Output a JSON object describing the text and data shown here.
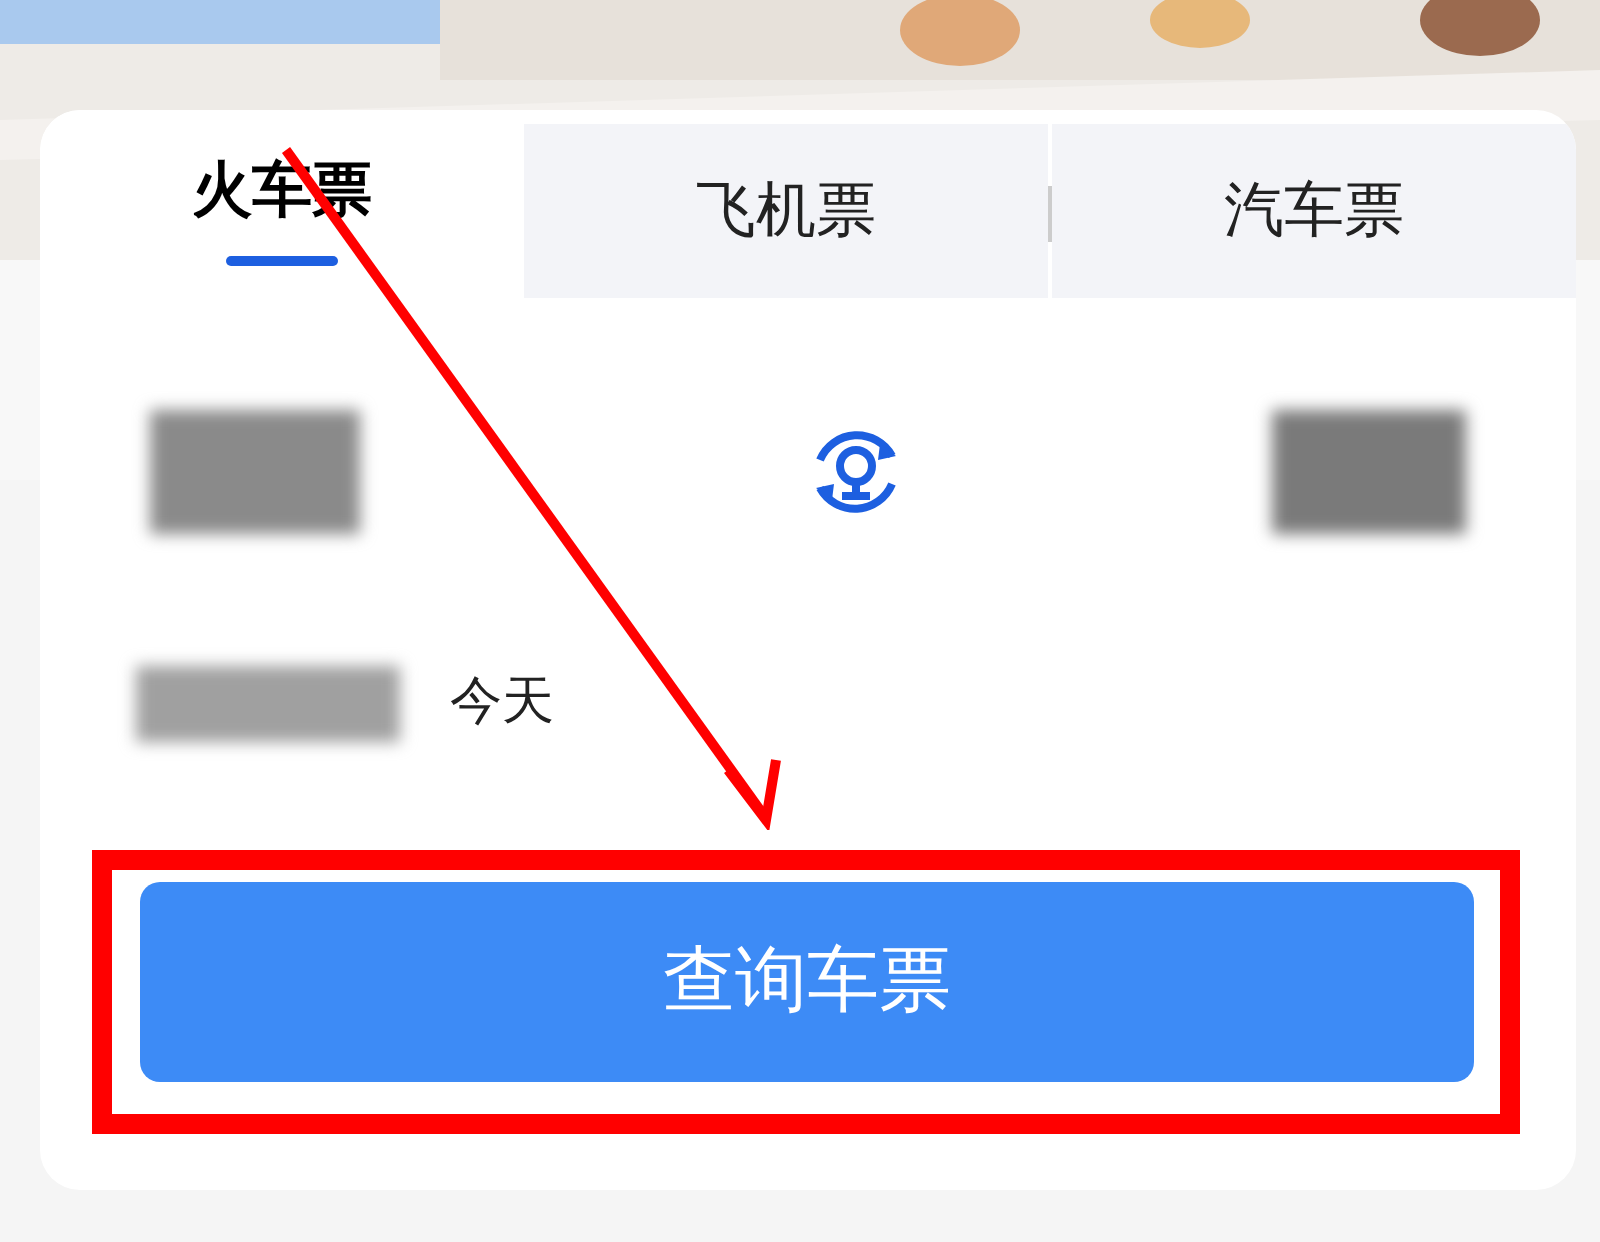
{
  "tabs": [
    {
      "label": "火车票",
      "selected": true
    },
    {
      "label": "飞机票",
      "selected": false
    },
    {
      "label": "汽车票",
      "selected": false
    }
  ],
  "date": {
    "day_label": "今天"
  },
  "search_button": {
    "label": "查询车票"
  }
}
